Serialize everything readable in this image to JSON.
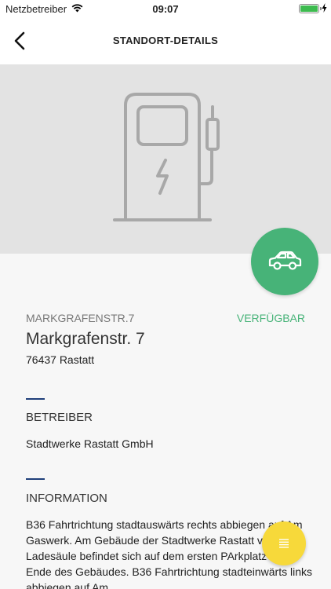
{
  "status_bar": {
    "carrier": "Netzbetreiber",
    "time": "09:07"
  },
  "nav": {
    "title": "STANDORT-DETAILS",
    "back_icon": "chevron-left-icon"
  },
  "hero": {
    "icon": "charging-station-icon"
  },
  "location": {
    "short_address": "MARKGRAFENSTR.7",
    "status": "VERFÜGBAR",
    "title": "Markgrafenstr. 7",
    "city": "76437 Rastatt"
  },
  "operator": {
    "heading": "BETREIBER",
    "name": "Stadtwerke Rastatt GmbH"
  },
  "information": {
    "heading": "INFORMATION",
    "text": "B36 Fahrtrichtung stadtauswärts rechts abbiegen auf Am Gaswerk. Am Gebäude der Stadtwerke Rastatt vorbei. Ladesäule befindet sich auf dem ersten PArkplatz nach Ende des Gebäudes. B36 Fahrtrichtung stadteinwärts links abbiegen auf Am"
  },
  "colors": {
    "accent_green": "#47b378",
    "divider_blue": "#1f3f7a",
    "fab_yellow": "#f7d93a"
  }
}
